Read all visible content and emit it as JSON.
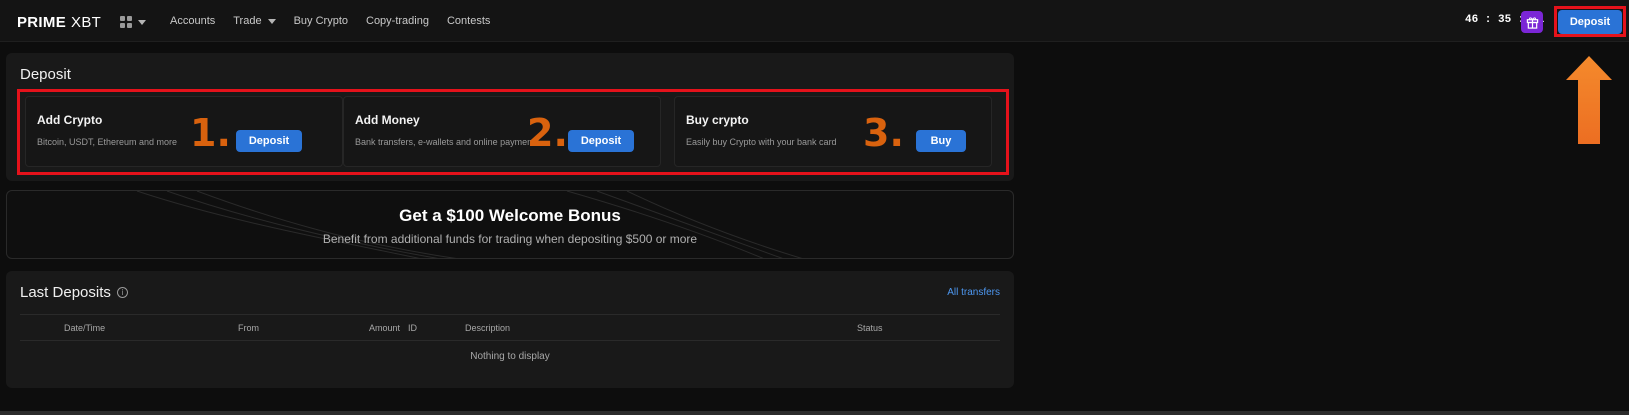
{
  "header": {
    "logo_part1": "PRIME",
    "logo_part2": "XBT",
    "nav": [
      "Accounts",
      "Trade",
      "Buy Crypto",
      "Copy-trading",
      "Contests"
    ],
    "timer": "46 : 35 : 21",
    "deposit_label": "Deposit"
  },
  "deposit_panel": {
    "title": "Deposit",
    "cards": [
      {
        "title": "Add Crypto",
        "subtitle": "Bitcoin, USDT, Ethereum and more",
        "number": "1.",
        "button": "Deposit"
      },
      {
        "title": "Add Money",
        "subtitle": "Bank transfers, e-wallets and online payments",
        "number": "2.",
        "button": "Deposit"
      },
      {
        "title": "Buy crypto",
        "subtitle": "Easily buy Crypto with your bank card",
        "number": "3.",
        "button": "Buy"
      }
    ]
  },
  "bonus": {
    "heading": "Get a $100 Welcome Bonus",
    "subtext": "Benefit from additional funds for trading when depositing $500 or more"
  },
  "last_deposits": {
    "title": "Last Deposits",
    "link": "All transfers",
    "columns": [
      "Date/Time",
      "From",
      "Amount",
      "ID",
      "Description",
      "Status"
    ],
    "empty_text": "Nothing to display"
  },
  "colors": {
    "accent_blue": "#2a73d6",
    "highlight_red": "#e5121b",
    "annotation_orange": "#d9620e",
    "arrow_orange": "#f07a28",
    "gift_purple": "#7b26d6"
  }
}
